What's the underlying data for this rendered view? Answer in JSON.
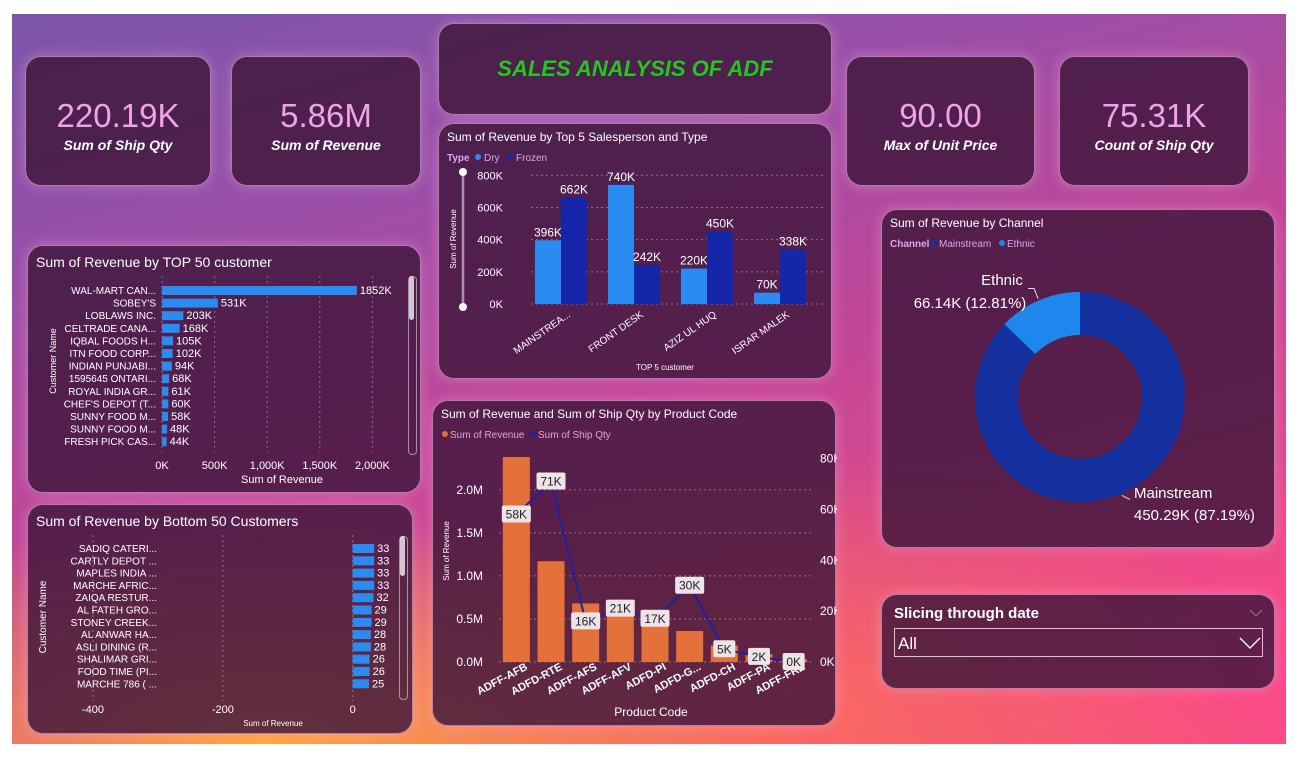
{
  "kpis": [
    {
      "value": "220.19K",
      "label": "Sum of Ship Qty"
    },
    {
      "value": "5.86M",
      "label": "Sum of Revenue"
    },
    {
      "value": "90.00",
      "label": "Max of Unit Price"
    },
    {
      "value": "75.31K",
      "label": "Count of Ship Qty"
    }
  ],
  "header": {
    "title": "SALES ANALYSIS OF ADF"
  },
  "colors": {
    "dry": "#2a8cf0",
    "frozen": "#1626a8",
    "bar": "#2a8cf0",
    "revenue": "#e4703a",
    "ship_qty": "#2020a0",
    "mainstream": "#15309f",
    "ethnic": "#1e87ee",
    "title_green": "#22c81e"
  },
  "slicer": {
    "title": "Slicing through date",
    "value": "All",
    "icon": "chevron-down-icon"
  },
  "chart_data": [
    {
      "id": "top50",
      "type": "bar",
      "orientation": "horizontal",
      "title": "Sum of Revenue by TOP 50 customer",
      "xlabel": "Sum of Revenue",
      "ylabel": "Customer Name",
      "xlim": [
        0,
        2300000
      ],
      "xticks": [
        {
          "v": 0,
          "t": "0K"
        },
        {
          "v": 500000,
          "t": "500K"
        },
        {
          "v": 1000000,
          "t": "1,000K"
        },
        {
          "v": 1500000,
          "t": "1,500K"
        },
        {
          "v": 2000000,
          "t": "2,000K"
        }
      ],
      "categories": [
        "WAL-MART CAN...",
        "SOBEY'S",
        "LOBLAWS INC.",
        "CELTRADE CANA...",
        "IQBAL FOODS H...",
        "ITN FOOD CORP...",
        "INDIAN PUNJABI...",
        "1595645 ONTARI...",
        "ROYAL INDIA GR...",
        "CHEF'S DEPOT (T...",
        "SUNNY FOOD M...",
        "SUNNY FOOD M...",
        "FRESH PICK CAS..."
      ],
      "values": [
        1852000,
        531000,
        203000,
        168000,
        105000,
        102000,
        94000,
        68000,
        61000,
        60000,
        58000,
        48000,
        44000
      ],
      "data_labels": [
        "1852K",
        "531K",
        "203K",
        "168K",
        "105K",
        "102K",
        "94K",
        "68K",
        "61K",
        "60K",
        "58K",
        "48K",
        "44K"
      ],
      "grid": true
    },
    {
      "id": "bottom50",
      "type": "bar",
      "orientation": "horizontal",
      "title": "Sum of Revenue by Bottom 50 Customers",
      "xlabel": "Sum of Revenue",
      "ylabel": "Customer Name",
      "xlim": [
        -500,
        42
      ],
      "xticks": [
        {
          "v": -400,
          "t": "-400"
        },
        {
          "v": -200,
          "t": "-200"
        },
        {
          "v": 0,
          "t": "0"
        }
      ],
      "categories": [
        "SADIQ CATERI...",
        "CARTLY DEPOT ...",
        "MAPLES INDIA ...",
        "MARCHE AFRIC...",
        "ZAIQA RESTUR...",
        "AL FATEH GRO...",
        "STONEY CREEK...",
        "AL ANWAR HA...",
        "ASLI DINING (R...",
        "SHALIMAR GRI...",
        "FOOD TIME (PI...",
        "MARCHE 786 ( ..."
      ],
      "values": [
        33,
        33,
        33,
        33,
        32,
        29,
        29,
        28,
        28,
        26,
        26,
        25
      ],
      "data_labels": [
        "33",
        "33",
        "33",
        "33",
        "32",
        "29",
        "29",
        "28",
        "28",
        "26",
        "26",
        "25"
      ],
      "grid": true
    },
    {
      "id": "salesperson",
      "type": "bar",
      "title": "Sum of Revenue by Top 5 Salesperson and Type",
      "legend_title": "Type",
      "xlabel": "TOP 5 customer",
      "ylabel": "Sum of Revenue",
      "ylim": [
        0,
        870000
      ],
      "yticks": [
        {
          "v": 0,
          "t": "0K"
        },
        {
          "v": 200000,
          "t": "200K"
        },
        {
          "v": 400000,
          "t": "400K"
        },
        {
          "v": 600000,
          "t": "600K"
        },
        {
          "v": 800000,
          "t": "800K"
        }
      ],
      "categories": [
        "MAINSTREA...",
        "FRONT DESK",
        "AZIZ UL HUQ",
        "ISRAR MALEK"
      ],
      "series": [
        {
          "name": "Dry",
          "values": [
            396000,
            740000,
            220000,
            70000
          ],
          "labels": [
            "396K",
            "740K",
            "220K",
            "70K"
          ]
        },
        {
          "name": "Frozen",
          "values": [
            662000,
            242000,
            450000,
            338000
          ],
          "labels": [
            "662K",
            "242K",
            "450K",
            "338K"
          ]
        }
      ],
      "grid": true
    },
    {
      "id": "productcode",
      "type": "bar",
      "title": "Sum of Revenue and Sum of Ship Qty by Product Code",
      "xlabel": "Product Code",
      "ylabel": "Sum of Revenue",
      "y2label": "Sum of Ship Qty",
      "ylim": [
        0,
        2450000
      ],
      "y2lim": [
        0,
        83000
      ],
      "yticks": [
        {
          "v": 0,
          "t": "0.0M"
        },
        {
          "v": 500000,
          "t": "0.5M"
        },
        {
          "v": 1000000,
          "t": "1.0M"
        },
        {
          "v": 1500000,
          "t": "1.5M"
        },
        {
          "v": 2000000,
          "t": "2.0M"
        }
      ],
      "y2ticks": [
        {
          "v": 0,
          "t": "0K"
        },
        {
          "v": 20000,
          "t": "20K"
        },
        {
          "v": 40000,
          "t": "40K"
        },
        {
          "v": 60000,
          "t": "60K"
        },
        {
          "v": 80000,
          "t": "80K"
        }
      ],
      "categories": [
        "ADFF-AFB",
        "ADFD-RTE",
        "ADFF-AFS",
        "ADFF-AFV",
        "ADFD-PI",
        "ADFD-G...",
        "ADFD-CH",
        "ADFF-PA",
        "ADFF-FRZ"
      ],
      "series": [
        {
          "name": "Sum of Revenue",
          "kind": "bar",
          "values": [
            2380000,
            1170000,
            680000,
            560000,
            440000,
            360000,
            190000,
            90000,
            30000
          ]
        },
        {
          "name": "Sum of Ship Qty",
          "kind": "line",
          "values": [
            58000,
            71000,
            16000,
            21000,
            17000,
            30000,
            5000,
            2000,
            0
          ],
          "labels": [
            "58K",
            "71K",
            "16K",
            "21K",
            "17K",
            "30K",
            "5K",
            "2K",
            "0K"
          ]
        }
      ],
      "grid": true
    },
    {
      "id": "channel",
      "type": "pie",
      "donut": true,
      "title": "Sum of Revenue by Channel",
      "legend_title": "Channel",
      "slices": [
        {
          "name": "Mainstream",
          "value": 450290,
          "label": "450.29K (87.19%)"
        },
        {
          "name": "Ethnic",
          "value": 66140,
          "label": "66.14K (12.81%)"
        }
      ]
    }
  ]
}
